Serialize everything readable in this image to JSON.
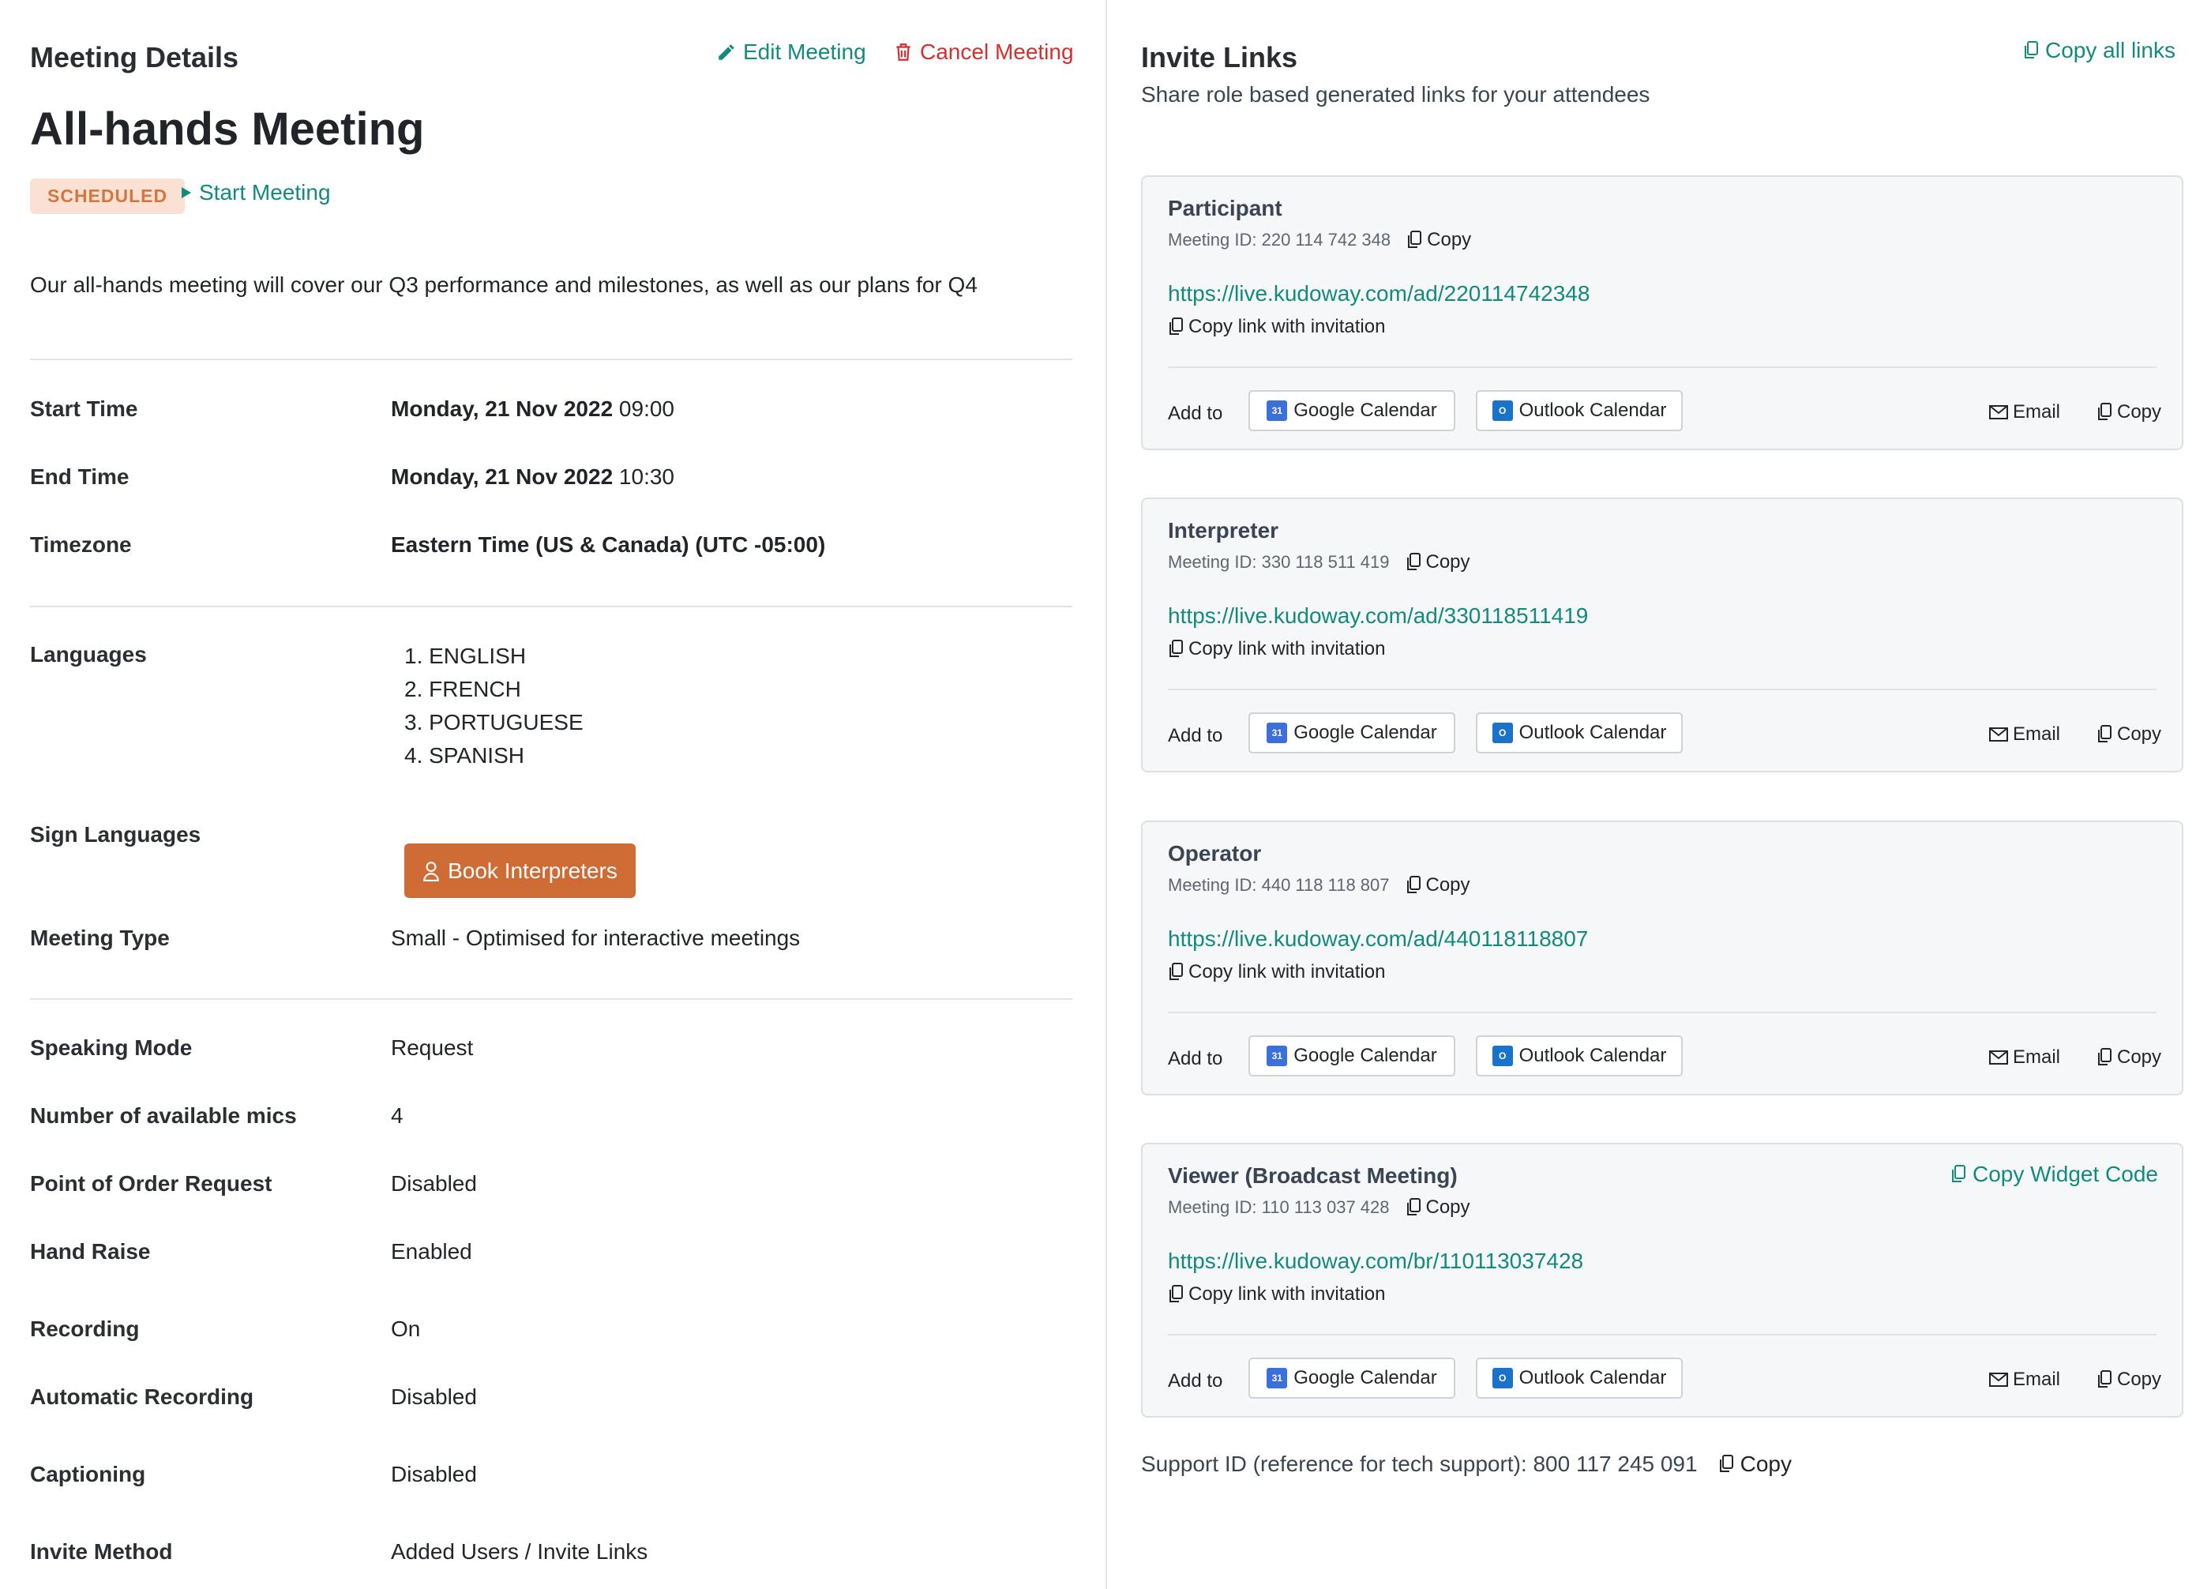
{
  "details": {
    "heading": "Meeting Details",
    "edit_label": "Edit Meeting",
    "cancel_label": "Cancel Meeting",
    "title": "All-hands Meeting",
    "status": "SCHEDULED",
    "start_label": "Start Meeting",
    "description": "Our all-hands meeting will cover our Q3 performance and milestones, as well as our plans for Q4",
    "start_time": {
      "label": "Start Time",
      "date": "Monday, 21 Nov 2022",
      "time": " 09:00"
    },
    "end_time": {
      "label": "End Time",
      "date": "Monday, 21 Nov 2022",
      "time": " 10:30"
    },
    "timezone": {
      "label": "Timezone",
      "value": "Eastern Time (US & Canada) (UTC -05:00)"
    },
    "languages": {
      "label": "Languages",
      "items": [
        "1. ENGLISH",
        "2. FRENCH",
        "3. PORTUGUESE",
        "4. SPANISH"
      ]
    },
    "sign_languages": {
      "label": "Sign Languages",
      "button": "Book Interpreters"
    },
    "meeting_type": {
      "label": "Meeting Type",
      "value": "Small - Optimised for interactive meetings"
    },
    "speaking_mode": {
      "label": "Speaking Mode",
      "value": "Request"
    },
    "mics": {
      "label": "Number of available mics",
      "value": "4"
    },
    "point_of_order": {
      "label": "Point of Order Request",
      "value": "Disabled"
    },
    "hand_raise": {
      "label": "Hand Raise",
      "value": "Enabled"
    },
    "recording": {
      "label": "Recording",
      "value": "On"
    },
    "auto_recording": {
      "label": "Automatic Recording",
      "value": "Disabled"
    },
    "captioning": {
      "label": "Captioning",
      "value": "Disabled"
    },
    "invite_method": {
      "label": "Invite Method",
      "value": "Added Users / Invite Links"
    }
  },
  "invite": {
    "heading": "Invite Links",
    "subtitle": "Share role based generated links for your attendees",
    "copy_all": "Copy all links",
    "common": {
      "copy": "Copy",
      "copy_invitation": "Copy link with invitation",
      "add_to": "Add to",
      "google": "Google Calendar",
      "outlook": "Outlook Calendar",
      "email": "Email",
      "widget": "Copy Widget Code"
    },
    "cards": [
      {
        "role": "Participant",
        "meeting_id": "Meeting ID: 220 114 742 348",
        "url": "https://live.kudoway.com/ad/220114742348"
      },
      {
        "role": "Interpreter",
        "meeting_id": "Meeting ID: 330 118 511 419",
        "url": "https://live.kudoway.com/ad/330118511419"
      },
      {
        "role": "Operator",
        "meeting_id": "Meeting ID: 440 118 118 807",
        "url": "https://live.kudoway.com/ad/440118118807"
      },
      {
        "role": "Viewer (Broadcast Meeting)",
        "meeting_id": "Meeting ID: 110 113 037 428",
        "url": "https://live.kudoway.com/br/110113037428"
      }
    ],
    "support": "Support ID (reference for tech support): 800 117 245 091"
  },
  "colors": {
    "accent": "#138a7e",
    "danger": "#d62e2e",
    "badge_bg": "#fbe1d3",
    "badge_text": "#d4773f",
    "book_button": "#cf6b34"
  }
}
